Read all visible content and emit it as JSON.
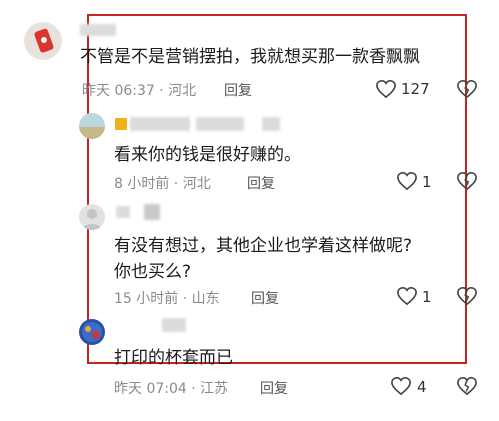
{
  "comments": [
    {
      "text": "不管是不是营销摆拍，我就想买那一款香飘飘",
      "time_location": "昨天 06:37 · 河北",
      "reply_label": "回复",
      "likes": "127"
    },
    {
      "text": "看来你的钱是很好赚的。",
      "time_location": "8 小时前 · 河北",
      "reply_label": "回复",
      "likes": "1"
    },
    {
      "text_line1": "有没有想过，其他企业也学着这样做呢?",
      "text_line2": "你也买么?",
      "time_location": "15 小时前 · 山东",
      "reply_label": "回复",
      "likes": "1"
    },
    {
      "text": "打印的杯套而已",
      "time_location": "昨天 07:04 · 江苏",
      "reply_label": "回复",
      "likes": "4"
    }
  ],
  "colors": {
    "highlight_border": "#c82323",
    "username_badge": "#f2b01e",
    "meta_text": "#8a8a8a"
  },
  "icons": [
    "heart-icon",
    "broken-heart-icon"
  ]
}
